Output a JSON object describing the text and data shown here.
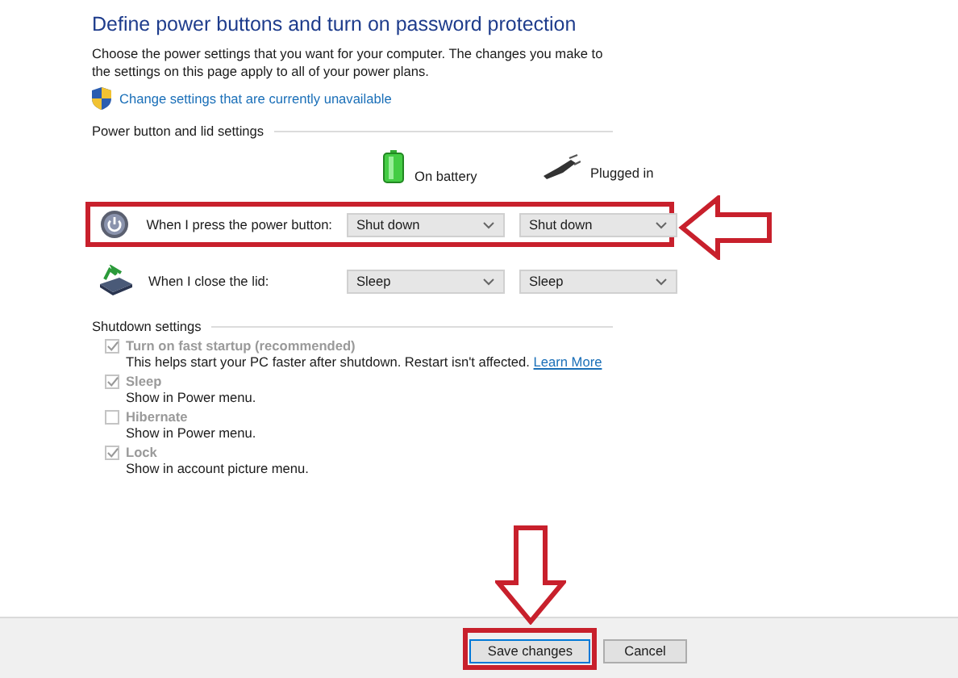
{
  "title": "Define power buttons and turn on password protection",
  "description": "Choose the power settings that you want for your computer. The changes you make to the settings on this page apply to all of your power plans.",
  "admin_link": "Change settings that are currently unavailable",
  "power_section": {
    "heading": "Power button and lid settings",
    "columns": [
      {
        "kind": "battery",
        "label": "On battery"
      },
      {
        "kind": "plug",
        "label": "Plugged in"
      }
    ],
    "rows": [
      {
        "kind": "power",
        "label": "When I press the power button:",
        "values": [
          "Shut down",
          "Shut down"
        ],
        "highlighted": true
      },
      {
        "kind": "lid",
        "label": "When I close the lid:",
        "values": [
          "Sleep",
          "Sleep"
        ],
        "highlighted": false
      }
    ]
  },
  "shutdown_section": {
    "heading": "Shutdown settings",
    "options": [
      {
        "label": "Turn on fast startup (recommended)",
        "description": "This helps start your PC faster after shutdown. Restart isn't affected.",
        "link": "Learn More",
        "checked": true,
        "disabled": true
      },
      {
        "label": "Sleep",
        "description": "Show in Power menu.",
        "checked": true,
        "disabled": true
      },
      {
        "label": "Hibernate",
        "description": "Show in Power menu.",
        "checked": false,
        "disabled": true
      },
      {
        "label": "Lock",
        "description": "Show in account picture menu.",
        "checked": true,
        "disabled": true
      }
    ]
  },
  "buttons": [
    {
      "label": "Save changes",
      "kind": "primary",
      "highlighted": true
    },
    {
      "label": "Cancel",
      "kind": "secondary",
      "highlighted": false
    }
  ]
}
